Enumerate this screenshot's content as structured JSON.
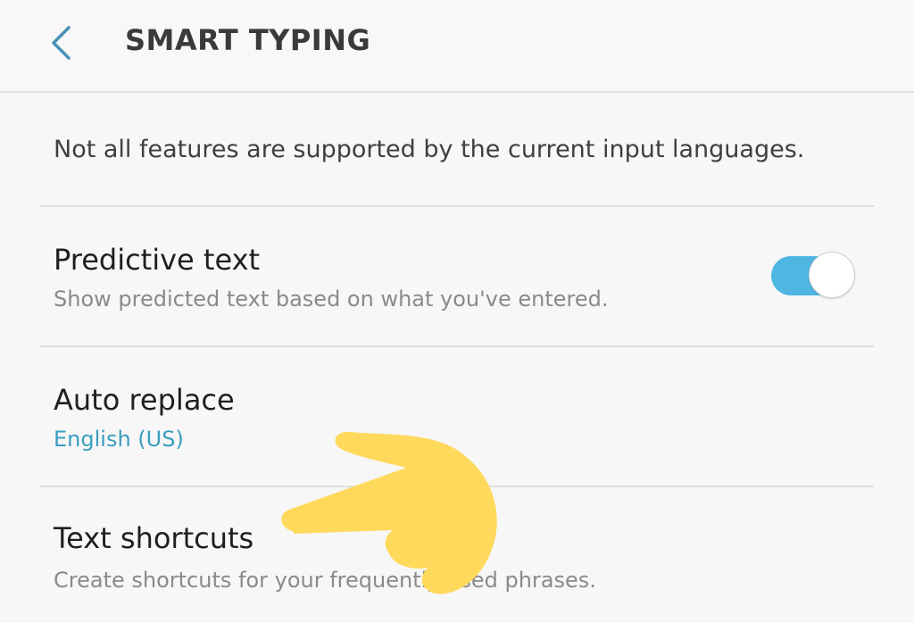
{
  "header": {
    "title": "SMART TYPING"
  },
  "notice": {
    "text": "Not all features are supported by the current input languages."
  },
  "settings": [
    {
      "title": "Predictive text",
      "subtitle": "Show predicted text based on what you've entered.",
      "toggle": true
    },
    {
      "title": "Auto replace",
      "subtitle": "English (US)"
    },
    {
      "title": "Text shortcuts",
      "subtitle": "Create shortcuts for your frequently used phrases."
    }
  ],
  "colors": {
    "accent": "#3a9dbf",
    "toggle_on": "#4fb6e2",
    "pointer": "#ffd95c"
  },
  "icons": {
    "back": "chevron-left-icon",
    "pointer": "pointing-hand-icon"
  }
}
